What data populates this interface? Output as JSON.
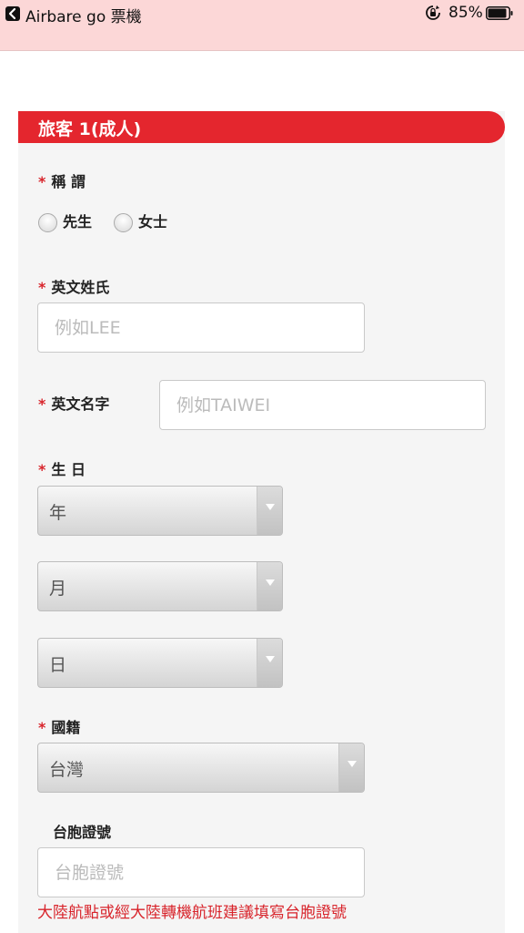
{
  "status_bar": {
    "app_name": "Airbare go 票機",
    "battery_percent": "85%",
    "icons": [
      "back-icon",
      "rotation-lock-icon",
      "battery-icon"
    ]
  },
  "form": {
    "section_title": "旅客 1(成人)",
    "required_mark": "*",
    "title_label": "稱 謂",
    "title_options": [
      "先生",
      "女士"
    ],
    "last_name_label": "英文姓氏",
    "last_name_placeholder": "例如LEE",
    "first_name_label": "英文名字",
    "first_name_placeholder": "例如TAIWEI",
    "birthday_label": "生 日",
    "birth_year": "年",
    "birth_month": "月",
    "birth_day": "日",
    "nationality_label": "國籍",
    "nationality_value": "台灣",
    "permit_label": "台胞證號",
    "permit_placeholder": "台胞證號",
    "permit_note": "大陸航點或經大陸轉機航班建議填寫台胞證號"
  },
  "colors": {
    "accent": "#e4262e",
    "status_bar": "#fcd7d7",
    "form_background": "#f5f5f5"
  }
}
